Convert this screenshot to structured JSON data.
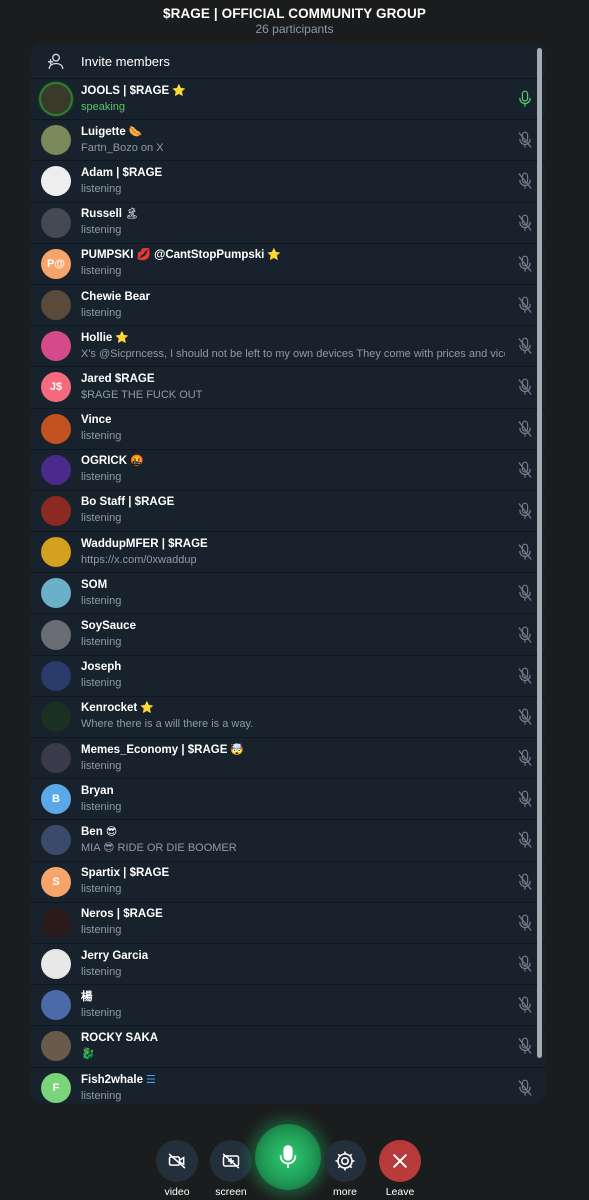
{
  "header": {
    "title": "$RAGE | OFFICIAL COMMUNITY GROUP",
    "subtitle": "26 participants"
  },
  "invite": {
    "label": "Invite members"
  },
  "participants": [
    {
      "name": "JOOLS | $RAGE",
      "badge": "⭐",
      "status": "speaking",
      "speaking": true,
      "initials": "",
      "color": "#3a3a2a",
      "mic": "on"
    },
    {
      "name": "Luigette",
      "badge": "🌭",
      "status": "Fartn_Bozo on X",
      "initials": "",
      "color": "#7a8a5a",
      "mic": "muted"
    },
    {
      "name": "Adam | $RAGE",
      "badge": "",
      "status": "listening",
      "initials": "",
      "color": "#eeeeee",
      "mic": "muted"
    },
    {
      "name": "Russell",
      "badge": "🏝",
      "status": "listening",
      "initials": "",
      "color": "#444a52",
      "mic": "muted"
    },
    {
      "name": "PUMPSKI 💋 @CantStopPumpski",
      "badge": "⭐",
      "status": "listening",
      "initials": "P@",
      "color": "#f5a46a",
      "mic": "muted"
    },
    {
      "name": "Chewie Bear",
      "badge": "",
      "status": "listening",
      "initials": "",
      "color": "#5a4a3a",
      "mic": "muted"
    },
    {
      "name": "Hollie",
      "badge": "⭐",
      "status": "X's @Sicprncess, I should not be left to my own devices They come with prices and vices",
      "initials": "",
      "color": "#d44a8a",
      "mic": "muted"
    },
    {
      "name": "Jared $RAGE",
      "badge": "",
      "status": "$RAGE THE FUCK OUT",
      "initials": "J$",
      "color": "#f56b7b",
      "mic": "muted"
    },
    {
      "name": "Vince",
      "badge": "",
      "status": "listening",
      "initials": "",
      "color": "#c2521f",
      "mic": "muted"
    },
    {
      "name": "OGRICK",
      "badge": "🤬",
      "status": "listening",
      "initials": "",
      "color": "#4a2a8a",
      "mic": "muted"
    },
    {
      "name": "Bo Staff | $RAGE",
      "badge": "",
      "status": "listening",
      "initials": "",
      "color": "#8a2a20",
      "mic": "muted"
    },
    {
      "name": "WaddupMFER | $RAGE",
      "badge": "",
      "status": "https://x.com/0xwaddup",
      "initials": "",
      "color": "#d4a020",
      "mic": "muted"
    },
    {
      "name": "SOM",
      "badge": "",
      "status": "listening",
      "initials": "",
      "color": "#6ab0c8",
      "mic": "muted"
    },
    {
      "name": "SoySauce",
      "badge": "",
      "status": "listening",
      "initials": "",
      "color": "#6a6e74",
      "mic": "muted"
    },
    {
      "name": "Joseph",
      "badge": "",
      "status": "listening",
      "initials": "",
      "color": "#2a3a6a",
      "mic": "muted"
    },
    {
      "name": "Kenrocket",
      "badge": "⭐",
      "status": "Where there is a will there is a way.",
      "initials": "",
      "color": "#1a3020",
      "mic": "muted"
    },
    {
      "name": "Memes_Economy | $RAGE",
      "badge": "🤯",
      "status": "listening",
      "initials": "",
      "color": "#3a3a4a",
      "mic": "muted"
    },
    {
      "name": "Bryan",
      "badge": "",
      "status": "listening",
      "initials": "B",
      "color": "#5aa8e8",
      "mic": "muted"
    },
    {
      "name": "Ben",
      "badge": "😎",
      "status": "MIA 😎 RIDE OR DIE BOOMER",
      "initials": "",
      "color": "#3a4a6a",
      "mic": "muted"
    },
    {
      "name": "Spartix | $RAGE",
      "badge": "",
      "status": "listening",
      "initials": "S",
      "color": "#f5a46a",
      "mic": "muted"
    },
    {
      "name": "Neros | $RAGE",
      "badge": "",
      "status": "listening",
      "initials": "",
      "color": "#2a1a1a",
      "mic": "muted"
    },
    {
      "name": "Jerry Garcia",
      "badge": "",
      "status": "listening",
      "initials": "",
      "color": "#e8e8e8",
      "mic": "muted"
    },
    {
      "name": "楊",
      "badge": "",
      "status": "listening",
      "initials": "",
      "color": "#4a6aa8",
      "mic": "muted"
    },
    {
      "name": "ROCKY SAKA",
      "badge": "",
      "status": "🐉",
      "initials": "",
      "color": "#6a5a4a",
      "mic": "muted"
    },
    {
      "name": "Fish2whale",
      "badge": "☰",
      "status": "listening",
      "initials": "F",
      "color": "#7ad47a",
      "mic": "muted"
    }
  ],
  "controls": {
    "video_label": "video",
    "screen_label": "screen",
    "more_label": "more",
    "leave_label": "Leave"
  },
  "colors": {
    "panel_bg": "#18222d",
    "speaking_green": "#5ac569",
    "leave_red": "#b93a3a"
  }
}
